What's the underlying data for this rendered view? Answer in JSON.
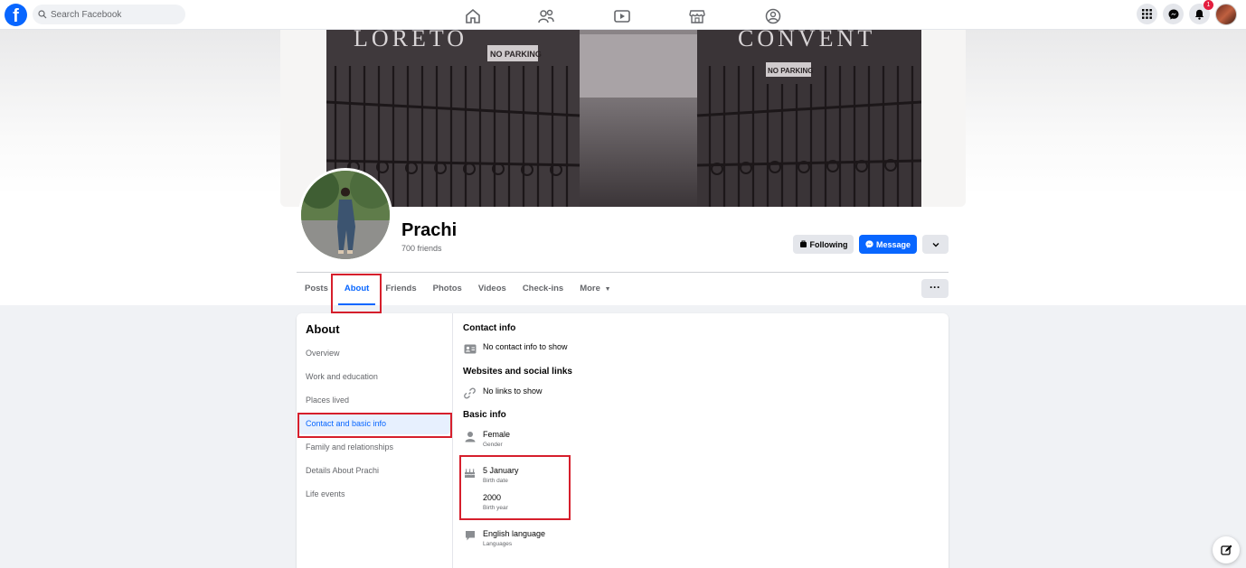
{
  "nav": {
    "search_placeholder": "Search Facebook",
    "notification_count": "1"
  },
  "cover": {
    "sign_top_left": "LORETO",
    "sign_top_right": "CONVENT",
    "sign_no_parking_1": "NO PARKING",
    "sign_no_parking_2": "NO PARKING"
  },
  "profile": {
    "name": "Prachi",
    "friends": "700 friends",
    "following_label": "Following",
    "message_label": "Message"
  },
  "tabs": [
    "Posts",
    "About",
    "Friends",
    "Photos",
    "Videos",
    "Check-ins",
    "More"
  ],
  "about": {
    "title": "About",
    "items": [
      "Overview",
      "Work and education",
      "Places lived",
      "Contact and basic info",
      "Family and relationships",
      "Details About Prachi",
      "Life events"
    ]
  },
  "contact": {
    "contact_title": "Contact info",
    "contact_empty": "No contact info to show",
    "websites_title": "Websites and social links",
    "websites_empty": "No links to show",
    "basic_title": "Basic info",
    "gender_value": "Female",
    "gender_label": "Gender",
    "birthdate_value": "5 January",
    "birthdate_label": "Birth date",
    "birthyear_value": "2000",
    "birthyear_label": "Birth year",
    "language_value": "English language",
    "language_label": "Languages"
  },
  "colors": {
    "accent": "#0866ff",
    "highlight": "#d61f2c"
  }
}
